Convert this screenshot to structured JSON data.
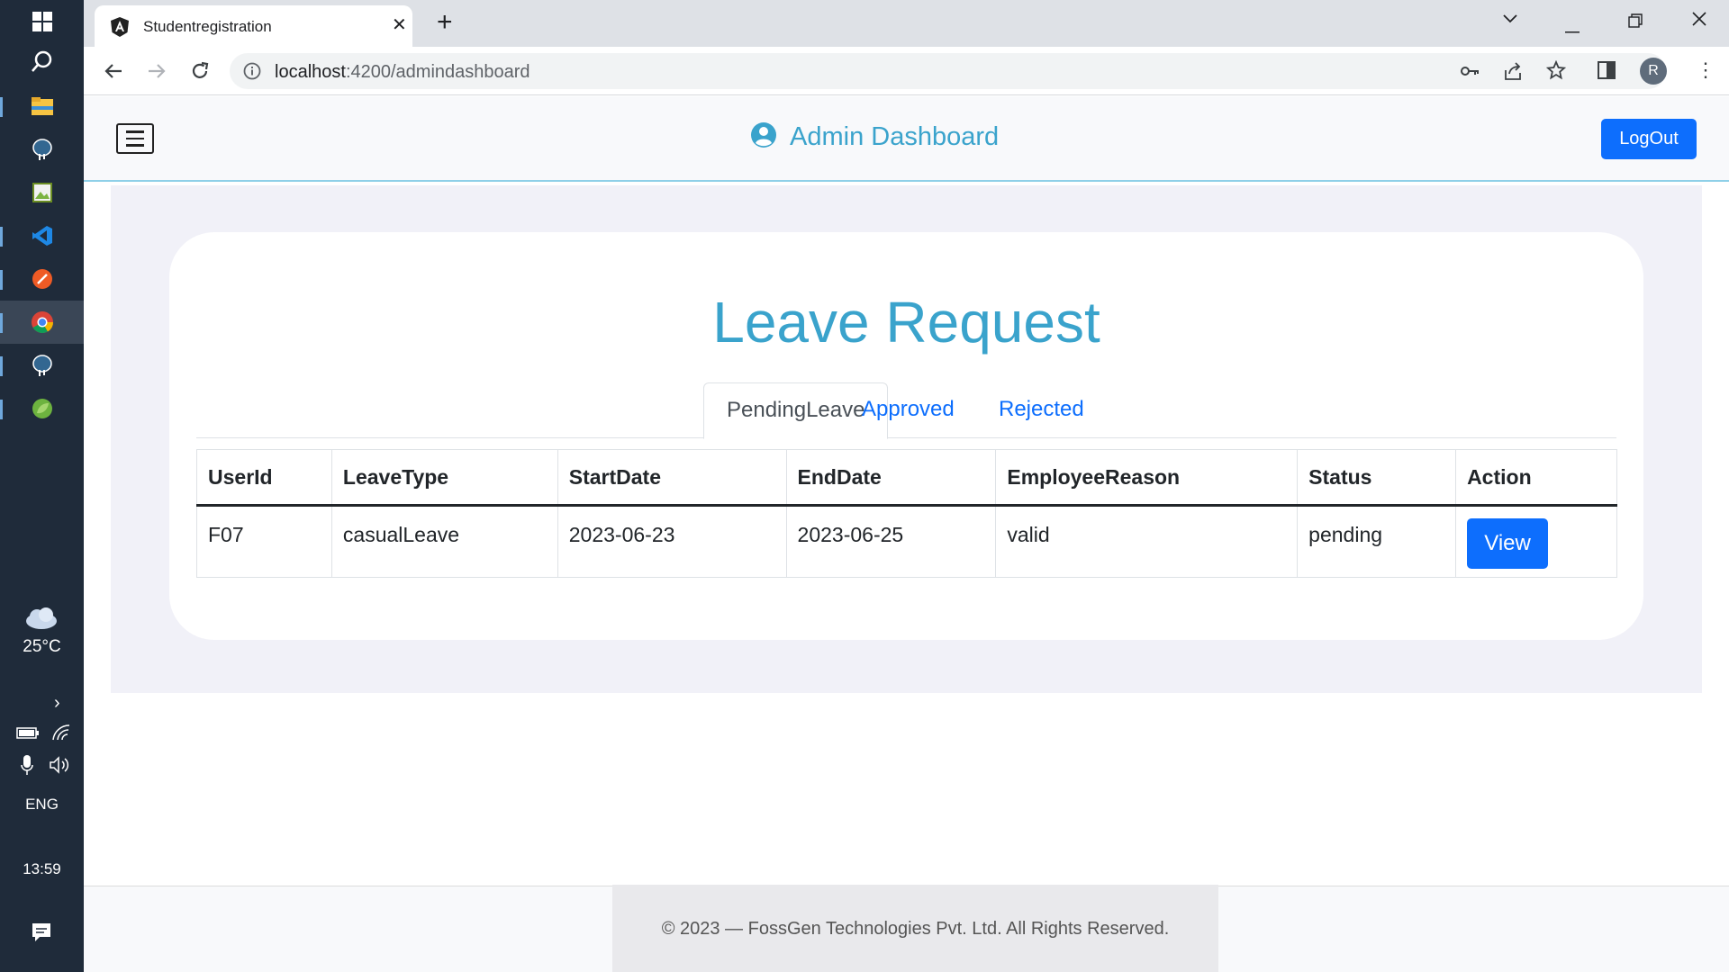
{
  "taskbar": {
    "weather": "25°C",
    "language": "ENG",
    "time": "13:59"
  },
  "browser": {
    "tab_title": "Studentregistration",
    "url_host": "localhost",
    "url_path": ":4200/admindashboard",
    "profile_initial": "R"
  },
  "header": {
    "title": "Admin Dashboard",
    "logout_label": "LogOut"
  },
  "card": {
    "title": "Leave Request",
    "tabs": [
      {
        "label": "PendingLeave",
        "active": true
      },
      {
        "label": "Approved",
        "active": false
      },
      {
        "label": "Rejected",
        "active": false
      }
    ]
  },
  "table": {
    "columns": [
      "UserId",
      "LeaveType",
      "StartDate",
      "EndDate",
      "EmployeeReason",
      "Status",
      "Action"
    ],
    "rows": [
      {
        "userid": "F07",
        "leavetype": "casualLeave",
        "startdate": "2023-06-23",
        "enddate": "2023-06-25",
        "reason": "valid",
        "status": "pending",
        "action_label": "View"
      }
    ]
  },
  "footer": {
    "text": "© 2023 — FossGen Technologies Pvt. Ltd. All Rights Reserved."
  },
  "colors": {
    "accent": "#3aa3cc",
    "primary_button": "#0d6efd",
    "taskbar": "#1f2b3a"
  }
}
